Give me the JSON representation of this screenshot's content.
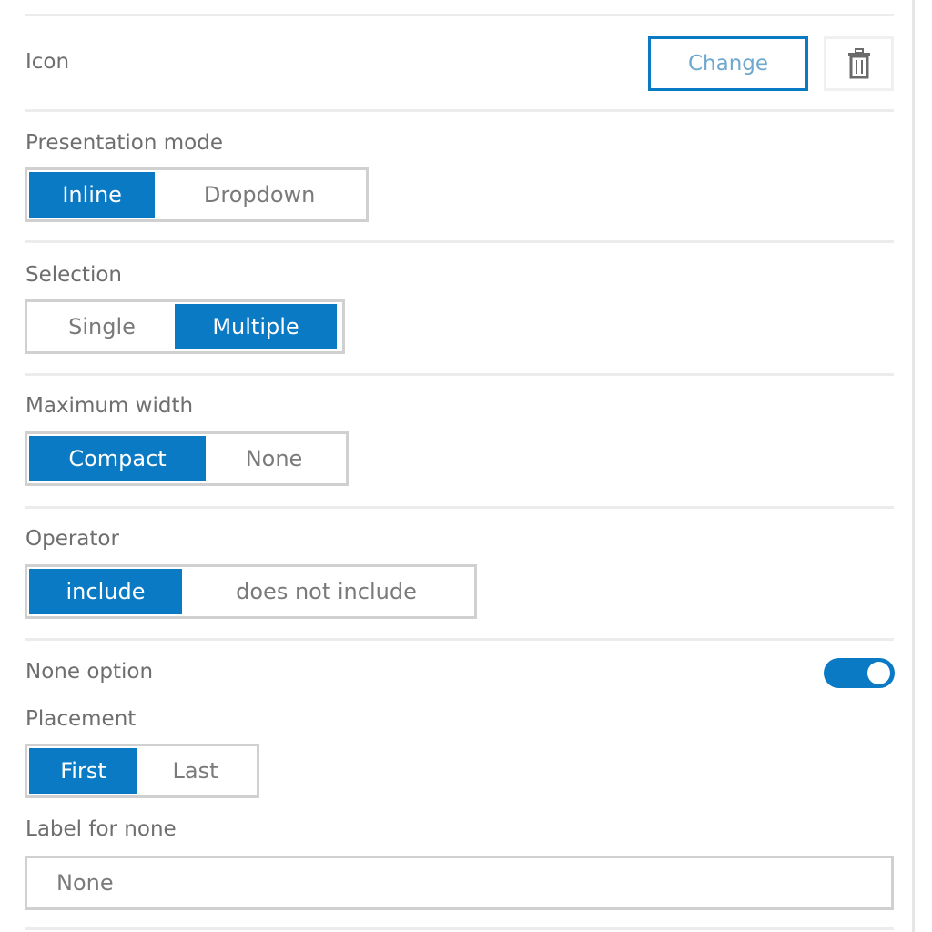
{
  "icon_row": {
    "label": "Icon",
    "change_label": "Change",
    "delete_icon": "trash-icon"
  },
  "presentation_mode": {
    "label": "Presentation mode",
    "options": [
      "Inline",
      "Dropdown"
    ],
    "selected": "Inline"
  },
  "selection": {
    "label": "Selection",
    "options": [
      "Single",
      "Multiple"
    ],
    "selected": "Multiple"
  },
  "maximum_width": {
    "label": "Maximum width",
    "options": [
      "Compact",
      "None"
    ],
    "selected": "Compact"
  },
  "operator": {
    "label": "Operator",
    "options": [
      "include",
      "does not include"
    ],
    "selected": "include"
  },
  "none_option": {
    "label": "None option",
    "enabled": true
  },
  "placement": {
    "label": "Placement",
    "options": [
      "First",
      "Last"
    ],
    "selected": "First"
  },
  "label_for_none": {
    "label": "Label for none",
    "value": "None"
  },
  "colors": {
    "accent": "#0b7ac4",
    "border": "#d0d0d0",
    "divider": "#ececec"
  }
}
